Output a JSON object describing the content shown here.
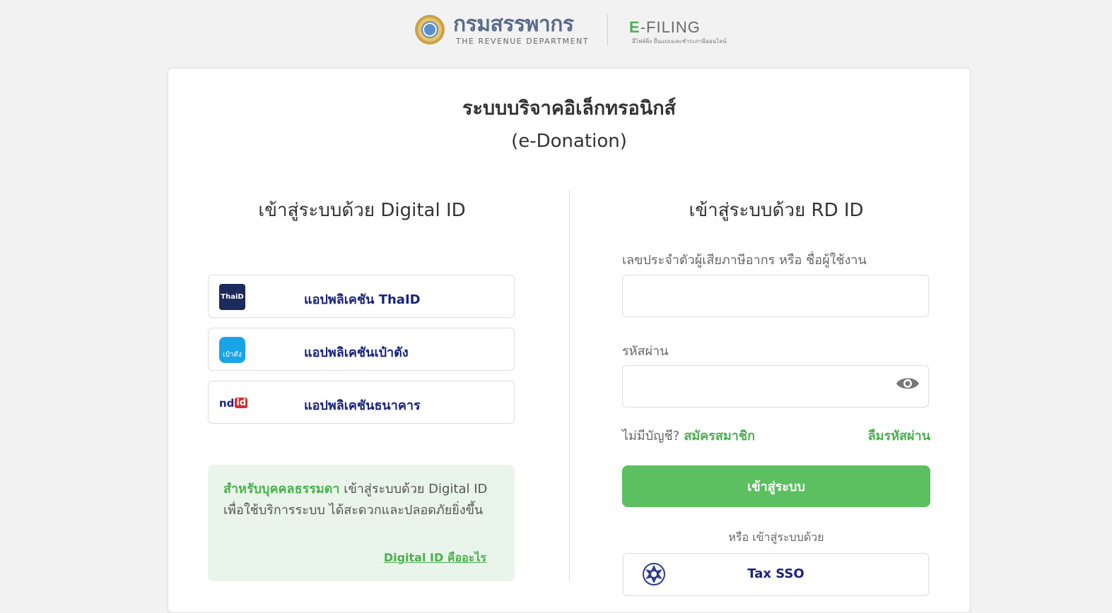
{
  "header": {
    "brand_th": "กรมสรรพากร",
    "brand_en": "THE REVENUE DEPARTMENT",
    "efiling_e": "E",
    "efiling_rest": "-FILING",
    "efiling_sub": "อีไฟล์ลิ่ง ยื่นแบบและชำระภาษีออนไลน์"
  },
  "page": {
    "title_th": "ระบบบริจาคอิเล็กทรอนิกส์",
    "title_en": "(e-Donation)"
  },
  "digital_id": {
    "title": "เข้าสู่ระบบด้วย Digital ID",
    "options": [
      {
        "logo_text": "ThaiD",
        "label": "แอปพลิเคชัน ThaID"
      },
      {
        "logo_text": "เป๋าตัง",
        "label": "แอปพลิเคชันเป๋าตัง"
      },
      {
        "logo_text": "nd",
        "logo_text2": "id",
        "label": "แอปพลิเคชันธนาคาร"
      }
    ],
    "info_strong": "สำหรับบุคคลธรรมดา",
    "info_text": " เข้าสู่ระบบด้วย Digital ID เพื่อใช้บริการระบบ ได้สะดวกและปลอดภัยยิ่งขึ้น",
    "info_link": "Digital ID คืออะไร"
  },
  "rd_id": {
    "title": "เข้าสู่ระบบด้วย RD ID",
    "username_label": "เลขประจำตัวผู้เสียภาษีอากร หรือ ชื่อผู้ใช้งาน",
    "username_value": "",
    "password_label": "รหัสผ่าน",
    "password_value": "",
    "no_account": "ไม่มีบัญชี?",
    "register": "สมัครสมาชิก",
    "forgot": "ลืมรหัสผ่าน",
    "login_button": "เข้าสู่ระบบ",
    "or_text": "หรือ เข้าสู่ระบบด้วย",
    "sso_label": "Tax SSO"
  },
  "colors": {
    "accent_green": "#5cbf60",
    "link_blue": "#1a237e"
  }
}
